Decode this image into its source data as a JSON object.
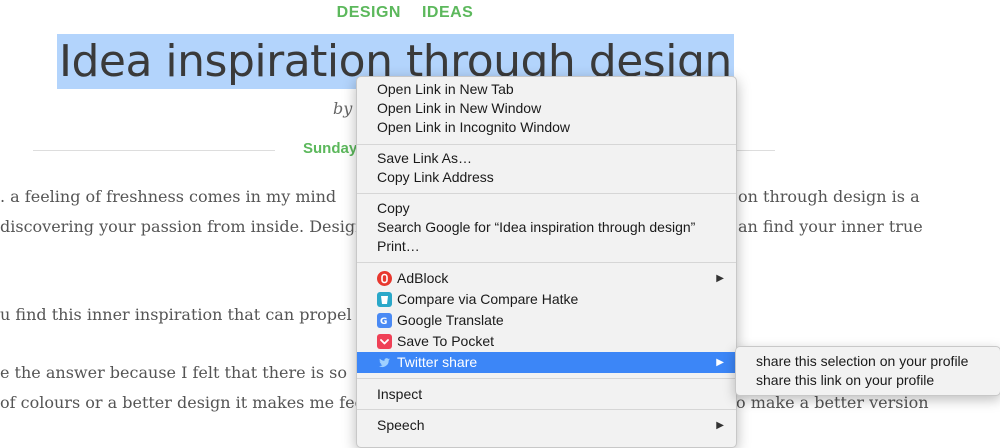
{
  "article": {
    "categories": [
      "DESIGN",
      "IDEAS"
    ],
    "title": "Idea inspiration through design",
    "byline": "by",
    "date": "Sunday",
    "paragraphs": [
      {
        "left": ". a feeling of freshness comes in my mind",
        "right": "on through design is a"
      },
      {
        "left": "discovering your passion from inside. Design",
        "right": "an find your inner true"
      },
      {
        "left": "u find this inner inspiration that can propel y",
        "right": ""
      },
      {
        "left": "e the answer because I felt that there is so",
        "right": ""
      },
      {
        "left": "of colours or a better design it makes me fee",
        "right": "o make a better version"
      }
    ]
  },
  "context_menu": {
    "items": {
      "open_new_tab": "Open Link in New Tab",
      "open_new_window": "Open Link in New Window",
      "open_incognito": "Open Link in Incognito Window",
      "save_link_as": "Save Link As…",
      "copy_link_address": "Copy Link Address",
      "copy": "Copy",
      "search_google": "Search Google for “Idea inspiration through design”",
      "print": "Print…",
      "adblock": "AdBlock",
      "compare_hatke": "Compare via Compare Hatke",
      "google_translate": "Google Translate",
      "save_to_pocket": "Save To Pocket",
      "twitter_share": "Twitter share",
      "inspect": "Inspect",
      "speech": "Speech"
    },
    "icons": {
      "adblock": "adblock-icon",
      "compare_hatke": "compare-hatke-icon",
      "google_translate": "google-translate-icon",
      "save_to_pocket": "pocket-icon",
      "twitter_share": "twitter-icon"
    },
    "highlighted_item": "twitter_share",
    "highlight_color": "#3c86f7"
  },
  "twitter_submenu": {
    "items": [
      "share this selection on your profile",
      "share this link on your profile"
    ]
  },
  "colors": {
    "category_green": "#5cb85c",
    "selection_blue": "#b3d4fc"
  }
}
